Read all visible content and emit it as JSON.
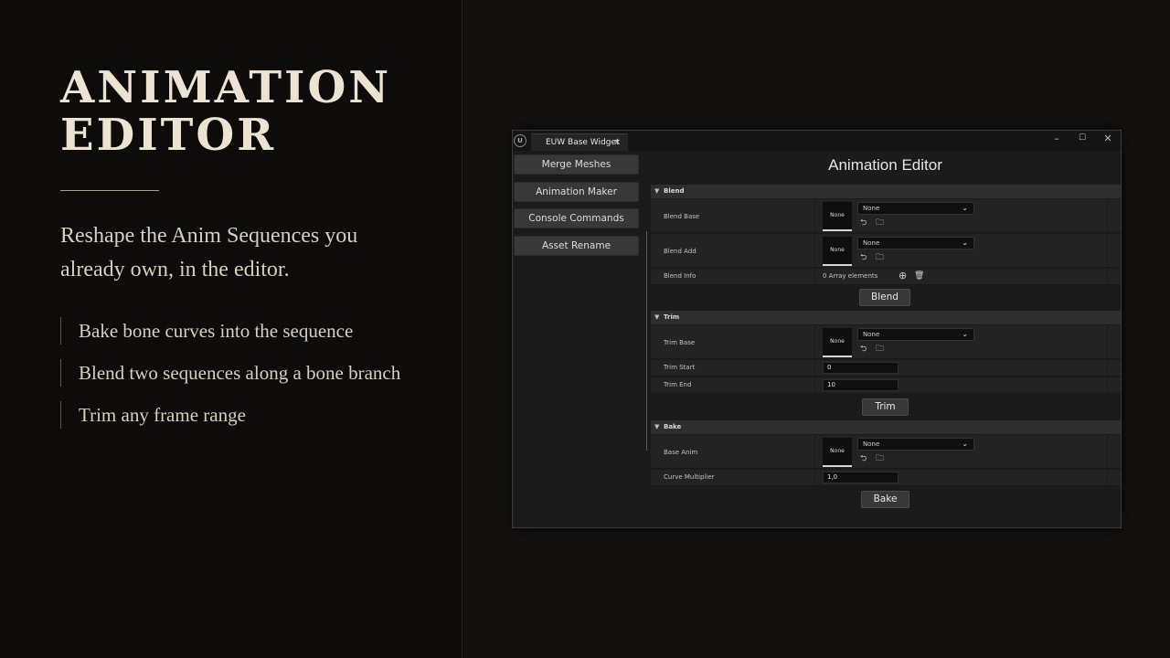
{
  "slide": {
    "title_line1": "ANIMATION",
    "title_line2": "EDITOR",
    "subtitle": "Reshape the Anim Sequences you already own, in the editor.",
    "bullets": [
      "Bake bone curves into the sequence",
      "Blend two sequences along a bone branch",
      "Trim any frame range"
    ]
  },
  "window": {
    "tab_label": "EUW Base Widget",
    "tab_close": "×",
    "logo": "U",
    "controls": {
      "minimize": "–",
      "maximize": "☐",
      "close": "✕"
    },
    "sidebar": [
      "Merge Meshes",
      "Animation Maker",
      "Console Commands",
      "Asset Rename"
    ],
    "heading": "Animation Editor",
    "blend": {
      "section": "Blend",
      "base_label": "Blend Base",
      "add_label": "Blend Add",
      "info_label": "Blend Info",
      "thumb_text": "None",
      "combo_value": "None",
      "array_text": "0 Array elements",
      "button": "Blend"
    },
    "trim": {
      "section": "Trim",
      "base_label": "Trim Base",
      "thumb_text": "None",
      "combo_value": "None",
      "start_label": "Trim Start",
      "start_value": "0",
      "end_label": "Trim End",
      "end_value": "10",
      "button": "Trim"
    },
    "bake": {
      "section": "Bake",
      "anim_label": "Base Anim",
      "thumb_text": "None",
      "combo_value": "None",
      "mult_label": "Curve Multiplier",
      "mult_value": "1,0",
      "button": "Bake"
    }
  },
  "icons": {
    "collapse_arrow": "▼",
    "chevron": "⌄",
    "use_selected": "⮌",
    "browse": "🗀",
    "add": "⊕",
    "delete": "🗑"
  }
}
